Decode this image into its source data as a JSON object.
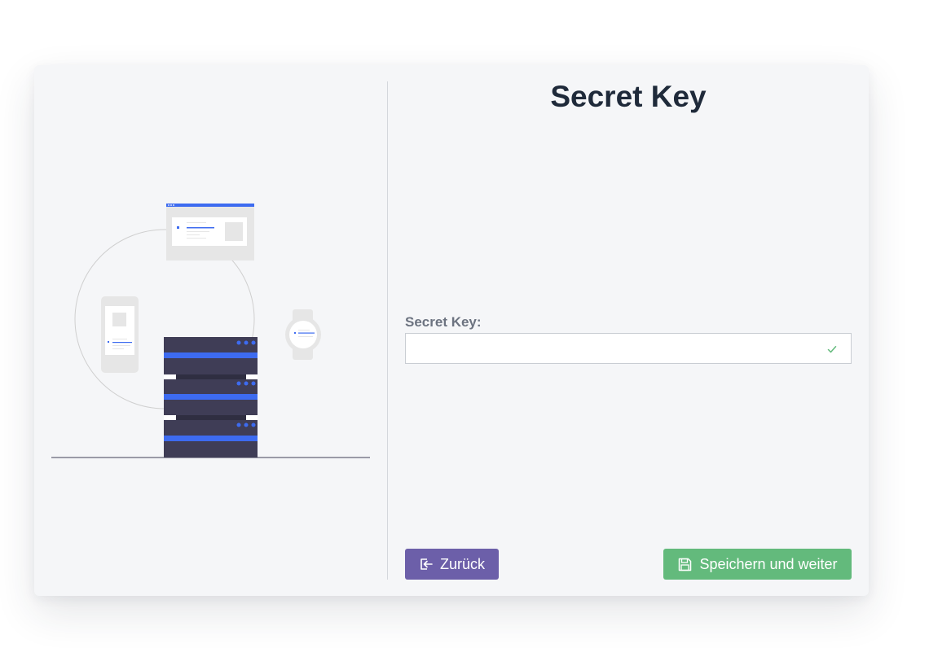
{
  "page": {
    "title": "Secret Key"
  },
  "form": {
    "secret_key_label": "Secret Key:",
    "secret_key_value": "",
    "secret_key_placeholder": ""
  },
  "buttons": {
    "back_label": "Zurück",
    "save_label": "Speichern und weiter"
  },
  "icons": {
    "back": "sign-out-icon",
    "save": "floppy-disk-icon",
    "valid": "check-icon"
  },
  "colors": {
    "back_button": "#6c5fa9",
    "save_button": "#63ba7c",
    "illustration_accent": "#3d6bf0",
    "server_body": "#3f3d56",
    "valid_check": "#63ba7c"
  }
}
